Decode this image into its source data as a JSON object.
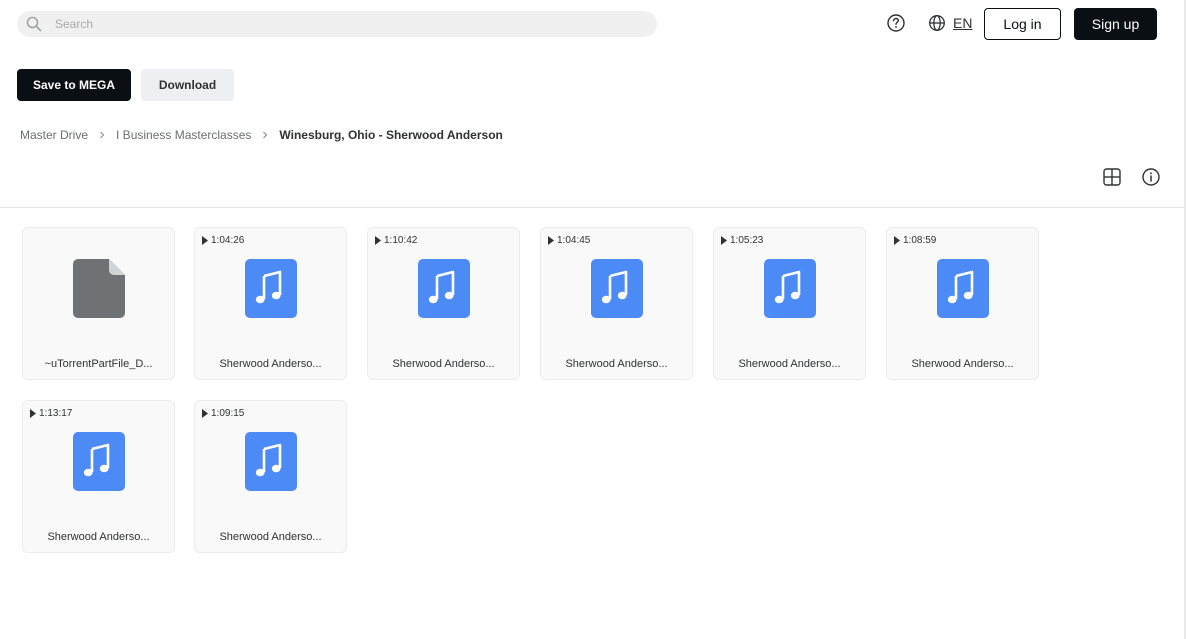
{
  "header": {
    "search_placeholder": "Search",
    "language": "EN",
    "login_label": "Log in",
    "signup_label": "Sign up",
    "icons": {
      "search": "search-icon",
      "help": "help-icon",
      "language": "globe-icon"
    }
  },
  "actions": {
    "save_label": "Save to MEGA",
    "download_label": "Download"
  },
  "breadcrumb": {
    "items": [
      "Master Drive",
      "I Business Masterclasses",
      "Winesburg, Ohio - Sherwood Anderson"
    ]
  },
  "view": {
    "icons": {
      "layout": "grid-view-icon",
      "info": "info-icon"
    }
  },
  "colors": {
    "primary_dark": "#0a0f14",
    "audio_icon": "#4c8af5",
    "generic_file_icon": "#6f7275"
  },
  "files": [
    {
      "name": "~uTorrentPartFile_D...",
      "type": "file",
      "duration": ""
    },
    {
      "name": "Sherwood Anderso...",
      "type": "audio",
      "duration": "1:04:26"
    },
    {
      "name": "Sherwood Anderso...",
      "type": "audio",
      "duration": "1:10:42"
    },
    {
      "name": "Sherwood Anderso...",
      "type": "audio",
      "duration": "1:04:45"
    },
    {
      "name": "Sherwood Anderso...",
      "type": "audio",
      "duration": "1:05:23"
    },
    {
      "name": "Sherwood Anderso...",
      "type": "audio",
      "duration": "1:08:59"
    },
    {
      "name": "Sherwood Anderso...",
      "type": "audio",
      "duration": "1:13:17"
    },
    {
      "name": "Sherwood Anderso...",
      "type": "audio",
      "duration": "1:09:15"
    }
  ]
}
